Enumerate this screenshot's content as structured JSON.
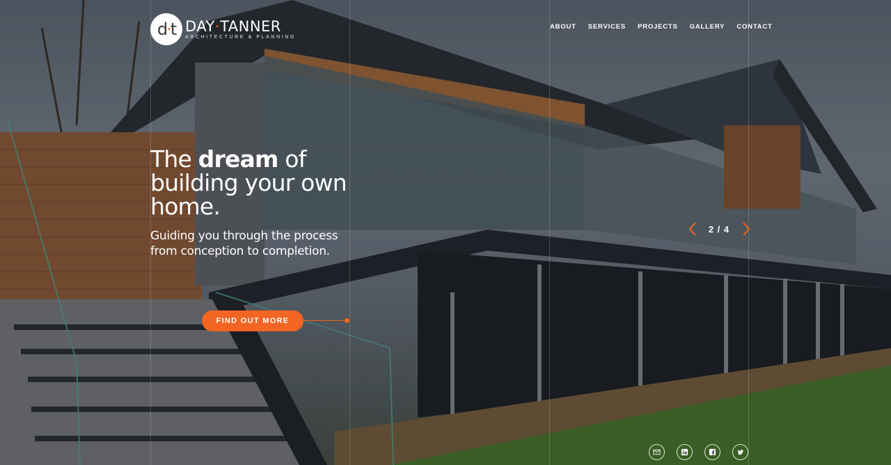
{
  "brand": {
    "mark_left": "d",
    "mark_dot": "·",
    "mark_right": "t",
    "name_first": "DAY",
    "name_sep": "·",
    "name_last": "TANNER",
    "tagline": "ARCHITECTURE & PLANNING",
    "accent_color": "#f26522"
  },
  "nav": {
    "items": [
      "ABOUT",
      "SERVICES",
      "PROJECTS",
      "GALLERY",
      "CONTACT"
    ]
  },
  "hero": {
    "headline_pre": "The ",
    "headline_bold": "dream",
    "headline_post": " of building your own home.",
    "subline": "Guiding you through the process from conception to completion.",
    "cta_label": "FIND OUT MORE"
  },
  "slider": {
    "counter": "2 / 4",
    "prev_icon": "chevron-left-icon",
    "next_icon": "chevron-right-icon"
  },
  "social": {
    "icons": [
      "mail-icon",
      "linkedin-icon",
      "facebook-icon",
      "twitter-icon"
    ]
  }
}
